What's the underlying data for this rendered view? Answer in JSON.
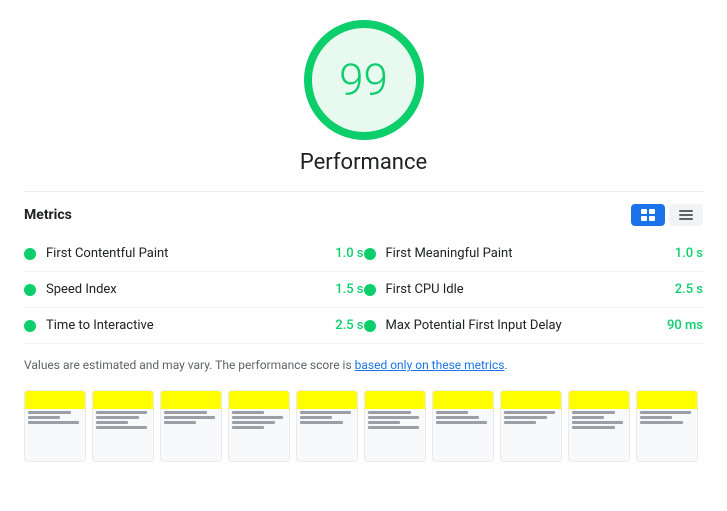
{
  "score": {
    "value": "99",
    "label": "Performance"
  },
  "metrics": {
    "title": "Metrics",
    "toggle": {
      "list_label": "list-view",
      "grid_label": "grid-view"
    },
    "items": [
      {
        "name": "First Contentful Paint",
        "value": "1.0 s",
        "color": "#0cce6b"
      },
      {
        "name": "First Meaningful Paint",
        "value": "1.0 s",
        "color": "#0cce6b"
      },
      {
        "name": "Speed Index",
        "value": "1.5 s",
        "color": "#0cce6b"
      },
      {
        "name": "First CPU Idle",
        "value": "2.5 s",
        "color": "#0cce6b"
      },
      {
        "name": "Time to Interactive",
        "value": "2.5 s",
        "color": "#0cce6b"
      },
      {
        "name": "Max Potential First Input Delay",
        "value": "90 ms",
        "color": "#0cce6b"
      }
    ]
  },
  "note": {
    "text_before": "Values are estimated and may vary. The performance score is ",
    "link_text": "based only on these metrics",
    "text_after": "."
  },
  "filmstrip": {
    "frames": [
      0,
      1,
      2,
      3,
      4,
      5,
      6,
      7,
      8,
      9,
      10
    ]
  }
}
